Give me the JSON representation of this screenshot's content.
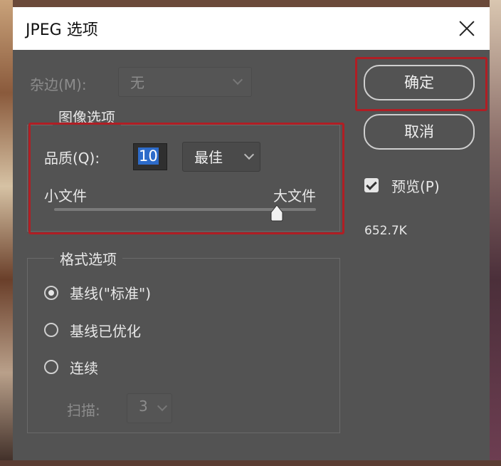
{
  "dialog": {
    "title": "JPEG 选项",
    "close_icon": "close-icon"
  },
  "matte": {
    "label": "杂边(M):",
    "value": "无",
    "enabled": false
  },
  "image_options": {
    "group_label": "图像选项",
    "quality_label": "品质(Q):",
    "quality_value": "10",
    "quality_preset": "最佳",
    "slider_min_label": "小文件",
    "slider_max_label": "大文件",
    "slider_level": 0.85
  },
  "format_options": {
    "group_label": "格式选项",
    "options": [
      {
        "label": "基线(\"标准\")",
        "checked": true
      },
      {
        "label": "基线已优化",
        "checked": false
      },
      {
        "label": "连续",
        "checked": false
      }
    ],
    "scans_label": "扫描:",
    "scans_value": "3"
  },
  "buttons": {
    "ok": "确定",
    "cancel": "取消"
  },
  "preview": {
    "label": "预览(P)",
    "checked": true,
    "file_size": "652.7K"
  },
  "colors": {
    "highlight": "#b01e24",
    "panel": "#535353",
    "selection": "#2d6bc9"
  }
}
